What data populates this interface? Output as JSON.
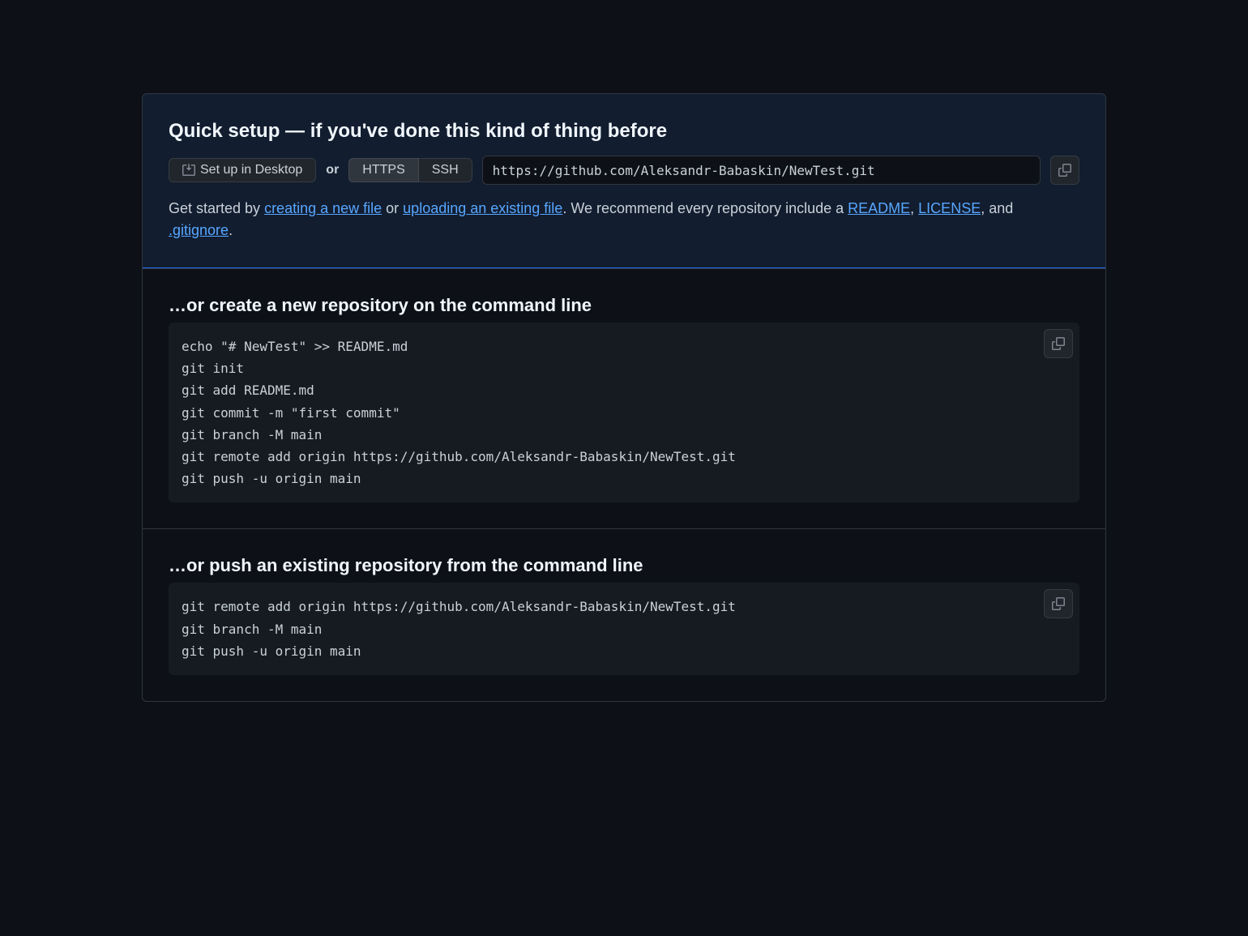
{
  "quickSetup": {
    "heading": "Quick setup — if you've done this kind of thing before",
    "setupDesktopLabel": "Set up in Desktop",
    "orLabel": "or",
    "httpsLabel": "HTTPS",
    "sshLabel": "SSH",
    "repoUrl": "https://github.com/Aleksandr-Babaskin/NewTest.git",
    "description": {
      "prefix": "Get started by ",
      "createLink": "creating a new file",
      "orText": " or ",
      "uploadLink": "uploading an existing file",
      "recommend": ". We recommend every repository include a ",
      "readmeLink": "README",
      "comma": ", ",
      "licenseLink": "LICENSE",
      "andText": ", and ",
      "gitignoreLink": ".gitignore",
      "period": "."
    }
  },
  "sections": {
    "create": {
      "heading": "…or create a new repository on the command line",
      "code": "echo \"# NewTest\" >> README.md\ngit init\ngit add README.md\ngit commit -m \"first commit\"\ngit branch -M main\ngit remote add origin https://github.com/Aleksandr-Babaskin/NewTest.git\ngit push -u origin main"
    },
    "push": {
      "heading": "…or push an existing repository from the command line",
      "code": "git remote add origin https://github.com/Aleksandr-Babaskin/NewTest.git\ngit branch -M main\ngit push -u origin main"
    }
  }
}
